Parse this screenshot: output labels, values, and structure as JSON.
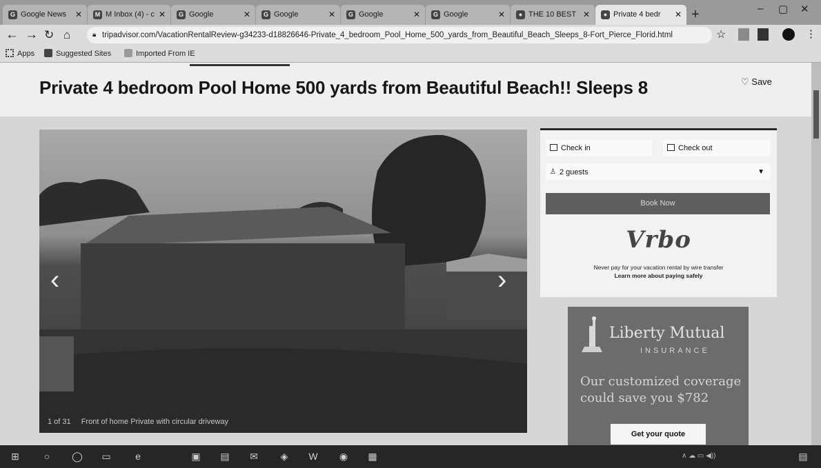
{
  "browser": {
    "tabs": [
      {
        "label": "Google News",
        "icon": "google-news-icon"
      },
      {
        "label": "M Inbox (4) - c",
        "icon": "gmail-icon"
      },
      {
        "label": "Google",
        "icon": "google-icon"
      },
      {
        "label": "Google",
        "icon": "google-icon"
      },
      {
        "label": "Google",
        "icon": "google-icon"
      },
      {
        "label": "Google",
        "icon": "google-icon"
      },
      {
        "label": "THE 10 BEST",
        "icon": "tripadvisor-icon"
      },
      {
        "label": "Private 4 bedr",
        "icon": "tripadvisor-icon",
        "active": true
      }
    ],
    "new_tab": "+",
    "url": "tripadvisor.com/VacationRentalReview-g34233-d18826646-Private_4_bedroom_Pool_Home_500_yards_from_Beautiful_Beach_Sleeps_8-Fort_Pierce_Florid.html",
    "bookmarks": {
      "apps": "Apps",
      "suggested": "Suggested Sites",
      "imported": "Imported From IE"
    }
  },
  "listing": {
    "title": "Private 4 bedroom Pool Home 500 yards from Beautiful Beach!! Sleeps 8",
    "save_label": "Save",
    "photo": {
      "counter": "1 of 31",
      "caption": "Front of home Private with circular driveway",
      "prev_glyph": "‹",
      "next_glyph": "›"
    }
  },
  "booking": {
    "check_in": "Check in",
    "check_out": "Check out",
    "guests": "2 guests",
    "book_button": "Book Now",
    "brand": "Vrbo",
    "note_line1": "Never pay for your vacation rental by wire transfer",
    "note_line2": "Learn more about paying safely"
  },
  "ad": {
    "brand": "Liberty Mutual",
    "sub": "INSURANCE",
    "text": "Our customized coverage could save you $782",
    "button": "Get your quote"
  },
  "colors": {
    "accent_dark": "#2a2a2a",
    "book_button": "#5e5e5e",
    "ad_bg": "#6c6c6c"
  }
}
